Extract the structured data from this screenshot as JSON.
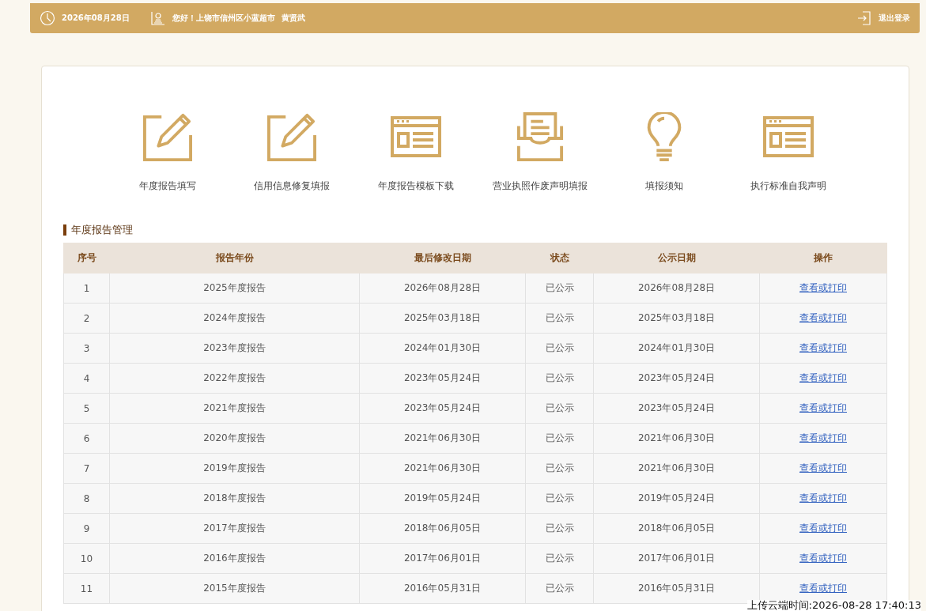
{
  "top_bar": {
    "date": "2026年08月28日",
    "greeting": "您好！上饶市信州区小蓝超市",
    "user": "黄贤武",
    "logout": "退出登录"
  },
  "shortcuts": [
    {
      "label": "年度报告填写",
      "kind": "edit"
    },
    {
      "label": "信用信息修复填报",
      "kind": "edit"
    },
    {
      "label": "年度报告模板下载",
      "kind": "form"
    },
    {
      "label": "营业执照作废声明填报",
      "kind": "inbox"
    },
    {
      "label": "填报须知",
      "kind": "bulb"
    },
    {
      "label": "执行标准自我声明",
      "kind": "form"
    }
  ],
  "section_title": "年度报告管理",
  "table": {
    "columns": [
      "序号",
      "报告年份",
      "最后修改日期",
      "状态",
      "公示日期",
      "操作"
    ],
    "rows": [
      [
        "1",
        "2025年度报告",
        "2026年08月28日",
        "已公示",
        "2026年08月28日",
        "查看或打印"
      ],
      [
        "2",
        "2024年度报告",
        "2025年03月18日",
        "已公示",
        "2025年03月18日",
        "查看或打印"
      ],
      [
        "3",
        "2023年度报告",
        "2024年01月30日",
        "已公示",
        "2024年01月30日",
        "查看或打印"
      ],
      [
        "4",
        "2022年度报告",
        "2023年05月24日",
        "已公示",
        "2023年05月24日",
        "查看或打印"
      ],
      [
        "5",
        "2021年度报告",
        "2023年05月24日",
        "已公示",
        "2023年05月24日",
        "查看或打印"
      ],
      [
        "6",
        "2020年度报告",
        "2021年06月30日",
        "已公示",
        "2021年06月30日",
        "查看或打印"
      ],
      [
        "7",
        "2019年度报告",
        "2021年06月30日",
        "已公示",
        "2021年06月30日",
        "查看或打印"
      ],
      [
        "8",
        "2018年度报告",
        "2019年05月24日",
        "已公示",
        "2019年05月24日",
        "查看或打印"
      ],
      [
        "9",
        "2017年度报告",
        "2018年06月05日",
        "已公示",
        "2018年06月05日",
        "查看或打印"
      ],
      [
        "10",
        "2016年度报告",
        "2017年06月01日",
        "已公示",
        "2017年06月01日",
        "查看或打印"
      ],
      [
        "11",
        "2015年度报告",
        "2016年05月31日",
        "已公示",
        "2016年05月31日",
        "查看或打印"
      ]
    ]
  },
  "upload_stamp": "上传云端时间:2026-08-28 17:40:13"
}
